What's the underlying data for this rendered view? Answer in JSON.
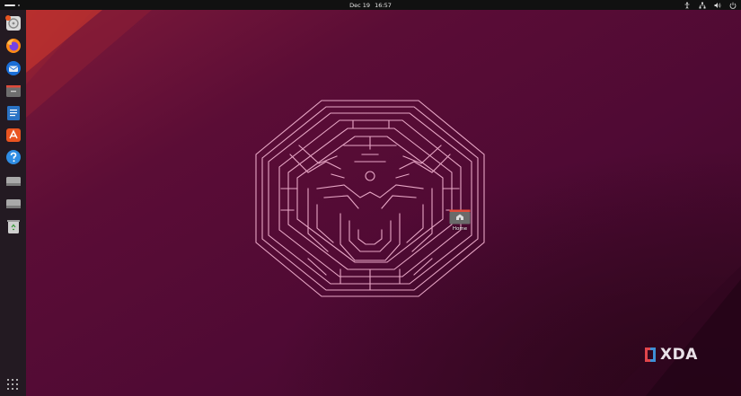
{
  "topbar": {
    "date": "Dec 19",
    "time": "16:57",
    "tray_icons": [
      "accessibility-icon",
      "network-icon",
      "volume-icon",
      "power-icon"
    ]
  },
  "dock": {
    "items": [
      {
        "name": "installer-icon"
      },
      {
        "name": "firefox-icon"
      },
      {
        "name": "thunderbird-icon"
      },
      {
        "name": "files-icon"
      },
      {
        "name": "libreoffice-writer-icon"
      },
      {
        "name": "app-center-icon"
      },
      {
        "name": "help-icon"
      },
      {
        "name": "drive-icon"
      },
      {
        "name": "drive-icon"
      },
      {
        "name": "trash-icon"
      }
    ],
    "show_apps": "show-apps-icon"
  },
  "desktop": {
    "home_label": "Home"
  },
  "watermark": {
    "text": "XDA"
  },
  "colors": {
    "wallpaper_base": "#4f0a34",
    "wallpaper_accent": "#b42a2c",
    "dock_bg": "#231a22",
    "topbar_bg": "#111111",
    "maze_line": "#e8a7c6"
  }
}
